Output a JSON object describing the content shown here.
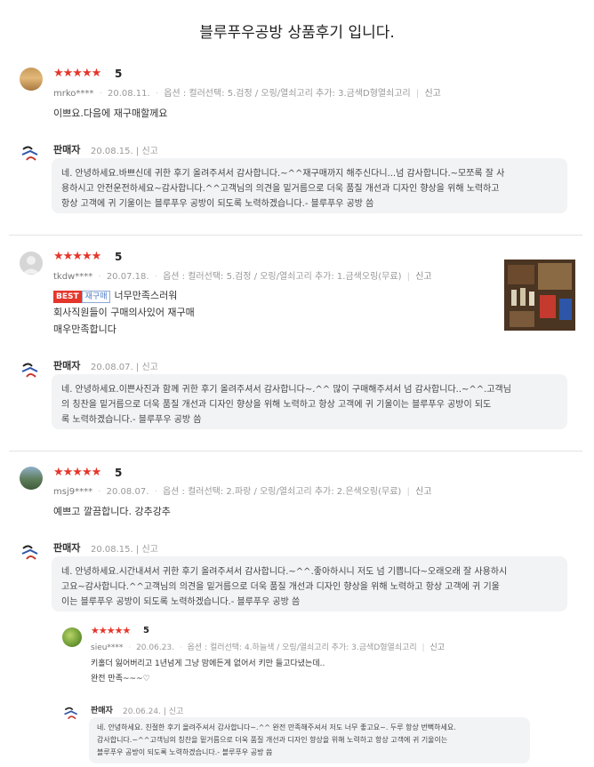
{
  "page": {
    "title": "블루푸우공방 상품후기 입니다."
  },
  "reviews": [
    {
      "stars": "★★★★★",
      "score": "5",
      "user": "mrko****",
      "date": "20.08.11.",
      "option": "옵션 : 컬러선택: 5.검정 / 오링/열쇠고리 추가: 3.금색D형열쇠고리",
      "report": "신고",
      "body": [
        "이쁘요.다음에 재구매할께요"
      ],
      "seller": {
        "name": "판매자",
        "date": "20.08.15.",
        "report": "신고",
        "lines": [
          "네. 안녕하세요.바쁘신데 귀한 후기 올려주셔서 감사합니다.~^^재구매까지 해주신다니...넘 감사합니다.~모쪼록 잘 사",
          "용하시고 안전운전하세요~감사합니다.^^고객님의 의견을 밑거름으로 더욱 품질 개선과 디자인 향상을 위해 노력하고",
          "항상 고객에 귀 기울이는 블루푸우 공방이 되도록 노력하겠습니다.- 블루푸우 공방 씀"
        ]
      }
    },
    {
      "stars": "★★★★★",
      "score": "5",
      "user": "tkdw****",
      "date": "20.07.18.",
      "option": "옵션 : 컬러선택: 5.검정 / 오링/열쇠고리 추가: 1.금색오링(무료)",
      "report": "신고",
      "badge_best": "BEST",
      "badge_repurchase": "재구매",
      "body": [
        "너무만족스러워",
        "회사직원들이 구매의사있어 재구매",
        "매우만족합니다"
      ],
      "seller": {
        "name": "판매자",
        "date": "20.08.07.",
        "report": "신고",
        "lines": [
          "네. 안녕하세요.이쁜사진과 함께 귀한 후기 올려주셔서 감사합니다~.^^ 많이 구매해주셔서 넘 감사합니다..~^^.고객님",
          "의 칭찬을 밑거름으로 더욱 품질 개선과 디자인 향상을 위해 노력하고 항상 고객에 귀 기울이는 블루푸우 공방이 되도",
          "록 노력하겠습니다.- 블루푸우 공방 씀"
        ]
      }
    },
    {
      "stars": "★★★★★",
      "score": "5",
      "user": "msj9****",
      "date": "20.08.07.",
      "option": "옵션 : 컬러선택: 2.파랑 / 오링/열쇠고리 추가: 2.은색오링(무료)",
      "report": "신고",
      "body": [
        "예쁘고 깔끔합니다. 강추강추"
      ],
      "seller": {
        "name": "판매자",
        "date": "20.08.15.",
        "report": "신고",
        "lines": [
          "네. 안녕하세요.시간내셔서 귀한 후기 올려주셔서 감사합니다.~^^.좋아하시니 저도 넘 기쁩니다~오래오래 잘 사용하시",
          "고요~감사합니다.^^고객님의 의견을 밑거름으로 더욱 품질 개선과 디자인 향상을 위해 노력하고 항상 고객에 귀 기울",
          "이는 블루푸우 공방이 되도록 노력하겠습니다.- 블루푸우 공방 씀"
        ]
      },
      "sub_review": {
        "stars": "★★★★★",
        "score": "5",
        "user": "sieu****",
        "date": "20.06.23.",
        "option": "옵션 : 컬러선택: 4.하늘색 / 오링/열쇠고리 추가: 3.금색D형열쇠고리",
        "report": "신고",
        "body": [
          "키홀더 잃어버리고 1년넘게 그냥 맘에든게 없어서 키만 들고다녔는데..",
          "완전 만족~~~♡"
        ],
        "seller": {
          "name": "판매자",
          "date": "20.06.24.",
          "report": "신고",
          "lines": [
            "네. 안녕하세요. 친절한 후기 올려주셔서 감사합니다~.^^ 완전 만족해주셔서 저도 너무 좋고요~. 두루 항상 번뻑하세요.",
            "감사합니다.~^^고객님의 칭찬을 밑거름으로 더욱 품질 개선과 디자인 향상을 위해 노력하고 항상 고객에 귀 기울이는",
            "블루푸우 공방이 되도록 노력하겠습니다.- 블루푸우 공방 씀"
          ]
        }
      }
    }
  ],
  "colors": {
    "star": "#e5362b",
    "bubble": "#f2f3f5",
    "badge_best": "#e5362b",
    "badge_repurchase": "#4b78c4"
  }
}
